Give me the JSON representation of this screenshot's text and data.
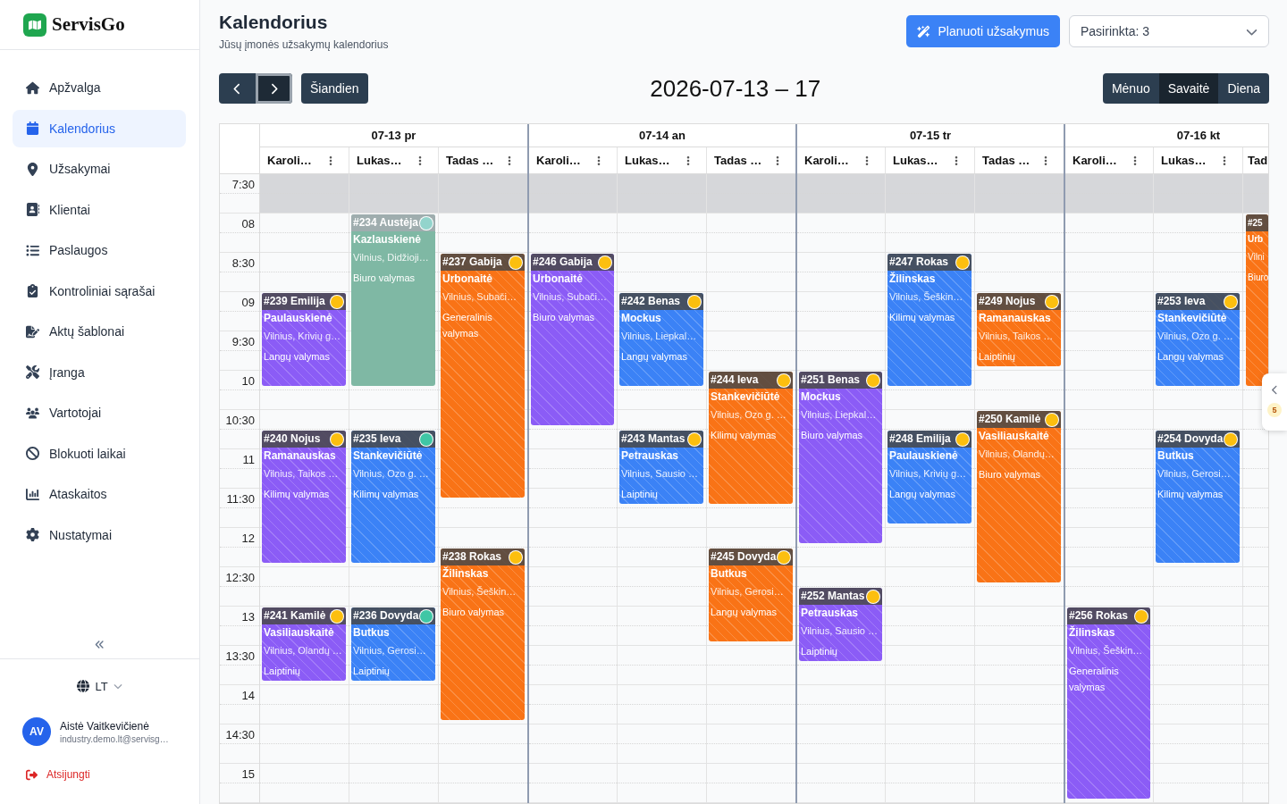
{
  "sidebar": {
    "brand": "ServisGo",
    "nav": [
      {
        "label": "Apžvalga",
        "selected": false
      },
      {
        "label": "Kalendorius",
        "selected": true
      },
      {
        "label": "Užsakymai",
        "selected": false
      },
      {
        "label": "Klientai",
        "selected": false
      },
      {
        "label": "Paslaugos",
        "selected": false
      },
      {
        "label": "Kontroliniai sąrašai",
        "selected": false
      },
      {
        "label": "Aktų šablonai",
        "selected": false
      },
      {
        "label": "Įranga",
        "selected": false
      },
      {
        "label": "Vartotojai",
        "selected": false
      },
      {
        "label": "Blokuoti laikai",
        "selected": false
      },
      {
        "label": "Ataskaitos",
        "selected": false
      },
      {
        "label": "Nustatymai",
        "selected": false
      }
    ],
    "language": "LT",
    "user": {
      "initials": "AV",
      "name": "Aistė Vaitkevičienė",
      "email": "industry.demo.lt@servisg…"
    },
    "logout": "Atsijungti"
  },
  "header": {
    "title": "Kalendorius",
    "subtitle": "Jūsų įmonės užsakymų kalendorius",
    "plan_button": "Planuoti užsakymus",
    "selection": "Pasirinkta: 3"
  },
  "toolbar": {
    "nav_buttons": [
      {
        "kind": "prev",
        "focused": false
      },
      {
        "kind": "next",
        "focused": true
      }
    ],
    "today": "Šiandien",
    "range": "2026-07-13 – 17",
    "views": [
      {
        "label": "Mėnuo",
        "selected": false
      },
      {
        "label": "Savaitė",
        "selected": true
      },
      {
        "label": "Diena",
        "selected": false
      }
    ]
  },
  "calendar": {
    "time_slots": [
      {
        "label": "7:30",
        "off_hours": true
      },
      {
        "label": "08",
        "off_hours": false
      },
      {
        "label": "8:30",
        "off_hours": false
      },
      {
        "label": "09",
        "off_hours": false
      },
      {
        "label": "9:30",
        "off_hours": false
      },
      {
        "label": "10",
        "off_hours": false
      },
      {
        "label": "10:30",
        "off_hours": false
      },
      {
        "label": "11",
        "off_hours": false
      },
      {
        "label": "11:30",
        "off_hours": false
      },
      {
        "label": "12",
        "off_hours": false
      },
      {
        "label": "12:30",
        "off_hours": false
      },
      {
        "label": "13",
        "off_hours": false
      },
      {
        "label": "13:30",
        "off_hours": false
      },
      {
        "label": "14",
        "off_hours": false
      },
      {
        "label": "14:30",
        "off_hours": false
      },
      {
        "label": "15",
        "off_hours": false
      }
    ],
    "days": [
      {
        "label": "07-13 pr",
        "resources": [
          {
            "name": "Karoli…",
            "events": [
              {
                "title": "#239 Emilija",
                "surname": "Paulauskienė",
                "address": "Vilnius, Krivių g…",
                "service": "Langų valymas",
                "color": "#8b5cf6",
                "faded": false,
                "status": {
                  "color": "#fcbf0f"
                }
              },
              {
                "title": "#240 Nojus",
                "surname": "Ramanauskas",
                "address": "Vilnius, Taikos …",
                "service": "Kilimų valymas",
                "color": "#8b5cf6",
                "faded": false,
                "status": {
                  "color": "#fcbf0f"
                }
              },
              {
                "title": "#241 Kamilė",
                "surname": "Vasiliauskaitė",
                "address": "Vilnius, Olandų …",
                "service": "Laiptinių",
                "color": "#8b5cf6",
                "faded": false,
                "status": {
                  "color": "#fcbf0f"
                }
              }
            ]
          },
          {
            "name": "Lukas…",
            "events": [
              {
                "title": "#234 Austėja",
                "surname": "Kazlauskienė",
                "address": "Vilnius, Didžioji…",
                "service": "Biuro valymas",
                "color": "#7fb8a4",
                "faded": true,
                "status": {
                  "color": "#93d4cc"
                }
              },
              {
                "title": "#235 Ieva",
                "surname": "Stankevičiūtė",
                "address": "Vilnius, Ozo g. …",
                "service": "Kilimų valymas",
                "color": "#3b82f6",
                "faded": false,
                "status": {
                  "color": "#3fc6a5"
                }
              },
              {
                "title": "#236 Dovyda",
                "surname": "Butkus",
                "address": "Vilnius, Gerosi…",
                "service": "Laiptinių",
                "color": "#3b82f6",
                "faded": false,
                "status": {
                  "color": "#3fc6a5"
                }
              }
            ]
          },
          {
            "name": "Tadas …",
            "events": [
              {
                "title": "#237 Gabija",
                "surname": "Urbonaitė",
                "address": "Vilnius, Subači…",
                "service": "Generalinis valymas",
                "color": "#f97316",
                "faded": false,
                "status": {
                  "color": "#fcbf0f"
                }
              },
              {
                "title": "#238 Rokas",
                "surname": "Žilinskas",
                "address": "Vilnius, Šeškin…",
                "service": "Biuro valymas",
                "color": "#f97316",
                "faded": false,
                "status": {
                  "color": "#fcbf0f"
                }
              }
            ]
          }
        ]
      },
      {
        "label": "07-14 an",
        "resources": [
          {
            "name": "Karoli…",
            "events": [
              {
                "title": "#246 Gabija",
                "surname": "Urbonaitė",
                "address": "Vilnius, Subači…",
                "service": "Biuro valymas",
                "color": "#8b5cf6",
                "faded": false,
                "status": {
                  "color": "#fcbf0f"
                }
              }
            ]
          },
          {
            "name": "Lukas…",
            "events": [
              {
                "title": "#242 Benas",
                "surname": "Mockus",
                "address": "Vilnius, Liepkal…",
                "service": "Langų valymas",
                "color": "#3b82f6",
                "faded": false,
                "status": {
                  "color": "#fcbf0f"
                }
              },
              {
                "title": "#243 Mantas",
                "surname": "Petrauskas",
                "address": "Vilnius, Sausio …",
                "service": "Laiptinių",
                "color": "#3b82f6",
                "faded": false,
                "status": {
                  "color": "#fcbf0f"
                }
              }
            ]
          },
          {
            "name": "Tadas …",
            "events": [
              {
                "title": "#244 Ieva",
                "surname": "Stankevičiūtė",
                "address": "Vilnius, Ozo g. …",
                "service": "Kilimų valymas",
                "color": "#f97316",
                "faded": false,
                "status": {
                  "color": "#fcbf0f"
                }
              },
              {
                "title": "#245 Dovyda",
                "surname": "Butkus",
                "address": "Vilnius, Gerosi…",
                "service": "Langų valymas",
                "color": "#f97316",
                "faded": false,
                "status": {
                  "color": "#fcbf0f"
                }
              }
            ]
          }
        ]
      },
      {
        "label": "07-15 tr",
        "resources": [
          {
            "name": "Karoli…",
            "events": [
              {
                "title": "#251 Benas",
                "surname": "Mockus",
                "address": "Vilnius, Liepkal…",
                "service": "Biuro valymas",
                "color": "#8b5cf6",
                "faded": false,
                "status": {
                  "color": "#fcbf0f"
                }
              },
              {
                "title": "#252 Mantas",
                "surname": "Petrauskas",
                "address": "Vilnius, Sausio …",
                "service": "Laiptinių",
                "color": "#8b5cf6",
                "faded": false,
                "status": {
                  "color": "#fcbf0f"
                }
              }
            ]
          },
          {
            "name": "Lukas…",
            "events": [
              {
                "title": "#247 Rokas",
                "surname": "Žilinskas",
                "address": "Vilnius, Šeškin…",
                "service": "Kilimų valymas",
                "color": "#3b82f6",
                "faded": false,
                "status": {
                  "color": "#fcbf0f"
                }
              },
              {
                "title": "#248 Emilija",
                "surname": "Paulauskienė",
                "address": "Vilnius, Krivių g…",
                "service": "Langų valymas",
                "color": "#3b82f6",
                "faded": false,
                "status": {
                  "color": "#fcbf0f"
                }
              }
            ]
          },
          {
            "name": "Tadas …",
            "events": [
              {
                "title": "#249 Nojus",
                "surname": "Ramanauskas",
                "address": "Vilnius, Taikos …",
                "service": "Laiptinių",
                "color": "#f97316",
                "faded": false,
                "status": {
                  "color": "#fcbf0f"
                }
              },
              {
                "title": "#250 Kamilė",
                "surname": "Vasiliauskaitė",
                "address": "Vilnius, Olandų…",
                "service": "Biuro valymas",
                "color": "#f97316",
                "faded": false,
                "status": {
                  "color": "#fcbf0f"
                }
              }
            ]
          }
        ]
      },
      {
        "label": "07-16 kt",
        "resources": [
          {
            "name": "Karoli…",
            "events": [
              {
                "title": "#256 Rokas",
                "surname": "Žilinskas",
                "address": "Vilnius, Šeškin…",
                "service": "Generalinis valymas",
                "color": "#8b5cf6",
                "faded": false,
                "status": {
                  "color": "#fcbf0f"
                }
              }
            ]
          },
          {
            "name": "Lukas…",
            "events": [
              {
                "title": "#253 Ieva",
                "surname": "Stankevičiūtė",
                "address": "Vilnius, Ozo g. …",
                "service": "Langų valymas",
                "color": "#3b82f6",
                "faded": false,
                "status": {
                  "color": "#fcbf0f"
                }
              },
              {
                "title": "#254 Dovyda",
                "surname": "Butkus",
                "address": "Vilnius, Gerosi…",
                "service": "Kilimų valymas",
                "color": "#3b82f6",
                "faded": false,
                "status": {
                  "color": "#fcbf0f"
                }
              }
            ]
          },
          {
            "name": "Tad",
            "events": [
              {
                "title": "#25",
                "surname": "Urb",
                "address": "Vilni",
                "service": "Biuro",
                "color": "#f97316",
                "faded": false
              }
            ]
          }
        ]
      }
    ]
  },
  "side_panel": {
    "badge": "5"
  }
}
